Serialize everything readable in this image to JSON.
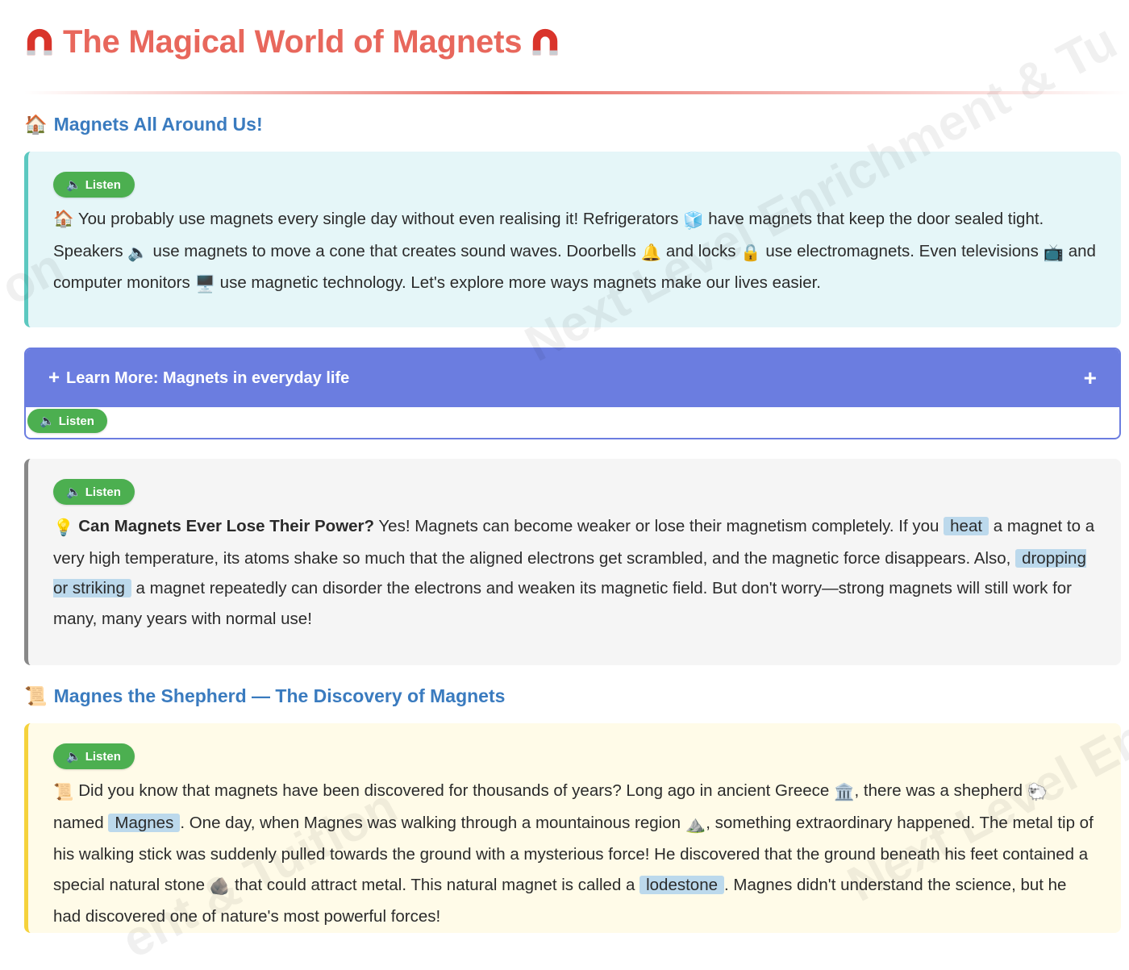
{
  "page": {
    "title": "The Magical World of Magnets",
    "title_icon": "magnet-icon",
    "accent_color": "#e8675c"
  },
  "watermark": {
    "text_1": "Next Level Enrichment & Tu",
    "text_2": "Next Level Enri",
    "text_3": "ent & Tuition",
    "text_4": "on"
  },
  "listen_label": "Listen",
  "sections": {
    "around_us": {
      "heading_icon": "🏠",
      "heading": "Magnets All Around Us!",
      "p": [
        "🏠 You probably use magnets every single day without even realising it! Refrigerators ",
        "🧊",
        " have magnets that keep the door sealed tight. Speakers ",
        "🔈",
        " use magnets to move a cone that creates sound waves. Doorbells ",
        "🔔",
        " and locks ",
        "🔒",
        " use electromagnets. Even televisions ",
        "📺",
        " and computer monitors ",
        "🖥️",
        " use magnetic technology. Let's explore more ways magnets make our lives easier."
      ]
    },
    "learn_more": {
      "title": "Learn More: Magnets in everyday life",
      "prefix_icon": "+",
      "toggle_icon": "+",
      "color": "#6b7de0"
    },
    "lose_power": {
      "bulb": "💡",
      "bold": "Can Magnets Ever Lose Their Power?",
      "t1": " Yes! Magnets can become weaker or lose their magnetism completely. If you ",
      "hl1": "heat",
      "t2": " a magnet to a very high temperature, its atoms shake so much that the aligned electrons get scrambled, and the magnetic force disappears. Also, ",
      "hl2": "dropping or striking",
      "t3": " a magnet repeatedly can disorder the electrons and weaken its magnetic field. But don't worry—strong magnets will still work for many, many years with normal use!"
    },
    "shepherd": {
      "heading_icon": "📜",
      "heading": "Magnes the Shepherd — The Discovery of Magnets",
      "scroll": "📜",
      "t1": " Did you know that magnets have been discovered for thousands of years? Long ago in ancient Greece ",
      "e1": "🏛️",
      "t2": ", there was a shepherd ",
      "e2": "🐑",
      "t3": " named ",
      "hl1": "Magnes",
      "t4": ". One day, when Magnes was walking through a mountainous region ",
      "e3": "⛰️",
      "t5": ", something extraordinary happened. The metal tip of his walking stick was suddenly pulled towards the ground with a mysterious force! He discovered that the ground beneath his feet contained a special natural stone ",
      "e4": "🪨",
      "t6": " that could attract metal. This natural magnet is called a ",
      "hl2": "lodestone",
      "t7": ". Magnes didn't understand the science, but he had discovered one of nature's most powerful forces!"
    }
  }
}
